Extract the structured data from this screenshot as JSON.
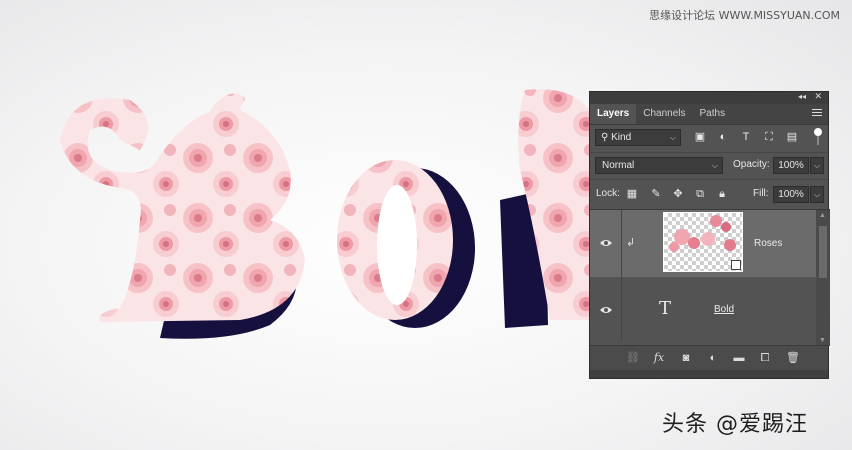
{
  "watermarks": {
    "top": "思缘设计论坛 WWW.MISSYUAN.COM",
    "bottom": "头条 @爱踢汪"
  },
  "canvas": {
    "text": "Bold",
    "fill_color": "#fbe4e6",
    "rose_color": "#f2a9b2",
    "rose_dark": "#d97b88",
    "dark_color": "#16103e"
  },
  "panel": {
    "tabs": [
      {
        "label": "Layers",
        "active": true
      },
      {
        "label": "Channels",
        "active": false
      },
      {
        "label": "Paths",
        "active": false
      }
    ],
    "filter": {
      "kind_label": "Kind"
    },
    "blend": {
      "mode": "Normal",
      "opacity_label": "Opacity:",
      "opacity_value": "100%"
    },
    "lock": {
      "label": "Lock:",
      "fill_label": "Fill:",
      "fill_value": "100%"
    },
    "layers": [
      {
        "name": "Roses",
        "selected": true,
        "visible": true,
        "clipped": true,
        "kind": "smart-object"
      },
      {
        "name": "Bold",
        "selected": false,
        "visible": true,
        "clipped": false,
        "kind": "type"
      }
    ],
    "colors": {
      "panel_bg": "#535353",
      "selected_row": "#6b6b6b",
      "field_bg": "#3c3c3c"
    }
  }
}
